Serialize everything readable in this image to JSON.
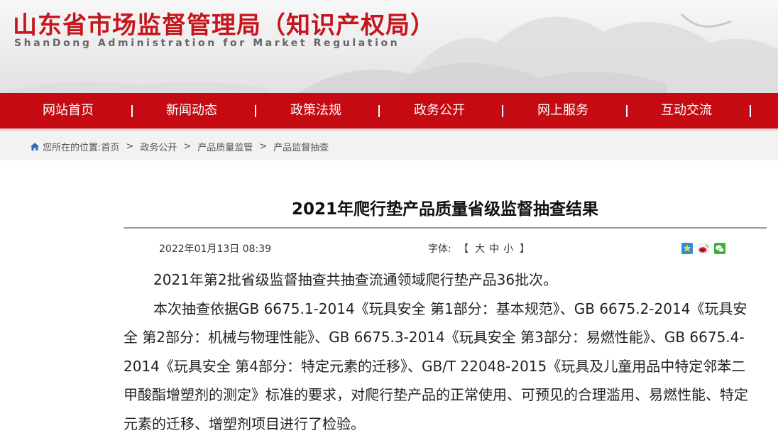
{
  "header": {
    "title": "山东省市场监督管理局（知识产权局）",
    "subtitle": "ShanDong Administration for Market Regulation"
  },
  "nav": {
    "items": [
      "网站首页",
      "新闻动态",
      "政策法规",
      "政务公开",
      "网上服务",
      "互动交流"
    ]
  },
  "breadcrumb": {
    "prefix": "您所在的位置:",
    "items": [
      "首页",
      "政务公开",
      "产品质量监管",
      "产品监督抽查"
    ],
    "separator": ">"
  },
  "article": {
    "title": "2021年爬行垫产品质量省级监督抽查结果",
    "date": "2022年01月13日 08:39",
    "font_label": "字体:",
    "font_open": "【",
    "font_close": "】",
    "font_sizes": [
      "大",
      "中",
      "小"
    ],
    "paragraphs": [
      "2021年第2批省级监督抽查共抽查流通领域爬行垫产品36批次。",
      "本次抽查依据GB 6675.1-2014《玩具安全 第1部分：基本规范》、GB 6675.2-2014《玩具安全 第2部分：机械与物理性能》、GB 6675.3-2014《玩具安全 第3部分：易燃性能》、GB 6675.4-2014《玩具安全 第4部分：特定元素的迁移》、GB/T 22048-2015《玩具及儿童用品中特定邻苯二甲酸酯增塑剂的测定》标准的要求，对爬行垫产品的正常使用、可预见的合理滥用、易燃性能、特定元素的迁移、增塑剂项目进行了检验。"
    ]
  },
  "share": {
    "icons": [
      "qzone-icon",
      "weibo-icon",
      "wechat-icon"
    ]
  },
  "colors": {
    "brand_red": "#c4161c",
    "nav_red": "#c60a12",
    "crumb_bg": "#f2f2f2"
  }
}
